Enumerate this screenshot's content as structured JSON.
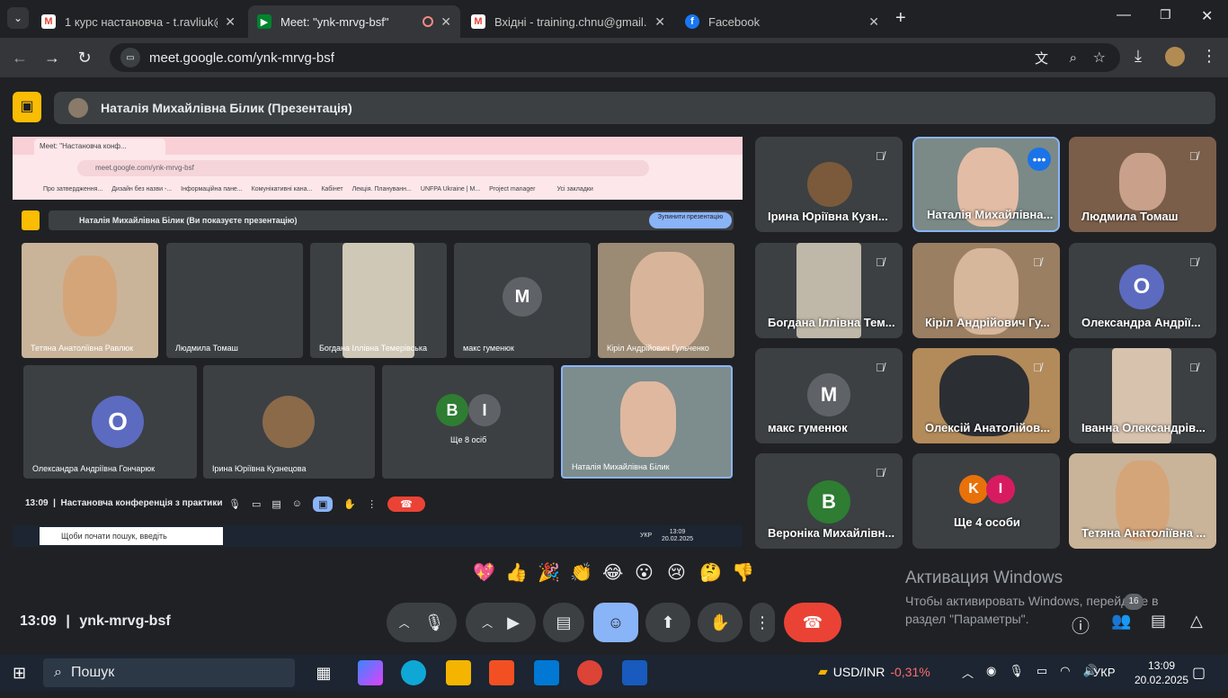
{
  "browser": {
    "tabs": [
      {
        "title": "1 курс настановча - t.ravliuk@",
        "icon": "gmail-icon",
        "active": false
      },
      {
        "title": "Meet: \"ynk-mrvg-bsf\"",
        "icon": "meet-icon",
        "active": true
      },
      {
        "title": "Вхідні - training.chnu@gmail.co",
        "icon": "gmail-icon",
        "active": false
      },
      {
        "title": "Facebook",
        "icon": "facebook-icon",
        "active": false
      }
    ],
    "url": "meet.google.com/ynk-mrvg-bsf"
  },
  "meet": {
    "presenter_banner": "Наталія Михайлівна Білик (Презентація)",
    "meeting_time": "13:09",
    "meeting_code": "ynk-mrvg-bsf",
    "participants_count": "16",
    "tiles": [
      {
        "name": "Ірина Юріївна Кузн...",
        "kind": "photo"
      },
      {
        "name": "Наталія Михайлівна...",
        "kind": "camera"
      },
      {
        "name": "Людмила Томаш",
        "kind": "camera"
      },
      {
        "name": "Богдана Іллівна Тем...",
        "kind": "camera"
      },
      {
        "name": "Кіріл Андрійович Гу...",
        "kind": "camera"
      },
      {
        "name": "Олександра Андрії...",
        "kind": "avatar",
        "letter": "О"
      },
      {
        "name": "макс гуменюк",
        "kind": "avatar",
        "letter": "М"
      },
      {
        "name": "Олексій Анатолійов...",
        "kind": "camera"
      },
      {
        "name": "Іванна Олександрів...",
        "kind": "camera"
      },
      {
        "name": "Вероніка Михайлівн...",
        "kind": "avatar",
        "letter": "В"
      },
      {
        "name": "Ще 4 особи",
        "kind": "more",
        "letters": [
          "K",
          "I"
        ]
      },
      {
        "name": "Тетяна Анатоліївна ...",
        "kind": "camera"
      }
    ],
    "emojis": [
      "💖",
      "👍",
      "🎉",
      "👏",
      "😂",
      "😮",
      "😢",
      "🤔",
      "👎"
    ],
    "activation": {
      "title": "Активация Windows",
      "text": "Чтобы активировать Windows, перейдите в раздел \"Параметры\"."
    }
  },
  "shared_screen": {
    "tab_title": "Meet: \"Настановча конф...",
    "url": "meet.google.com/ynk-mrvg-bsf",
    "bookmarks": [
      "Про затвердження...",
      "Дизайн без назви -...",
      "Інформаційна пане...",
      "Комунікативні кана...",
      "Кабінет",
      "Лекція. Плануванн...",
      "UNFPA Ukraine | М...",
      "Project manager",
      "Усі закладки"
    ],
    "banner": "Наталія Михайлівна Білик (Ви показуєте презентацію)",
    "stop_button": "Зупинити презентацію",
    "tiles_row1": [
      "Тетяна Анатоліївна Равлюк",
      "Людмила Томаш",
      "Богдана Іллівна Темерівська",
      "макс гуменюк",
      "Кіріл Андрійович Гульченко"
    ],
    "tiles_row2": [
      "Олександра Андріївна Гончарюк",
      "Ірина Юріївна Кузнецова",
      "Ще 8 осіб",
      "Наталія Михайлівна Білик"
    ],
    "time": "13:09",
    "meeting_name": "Настановча конференція з практики",
    "search_placeholder": "Щоби почати пошук, введіть",
    "tray_lang": "УКР",
    "tray_time": "13:09",
    "tray_date": "20.02.2025"
  },
  "taskbar": {
    "search_label": "Пошук",
    "ticker": "USD/INR",
    "ticker_change": "-0,31%",
    "lang": "УКР",
    "time": "13:09",
    "date": "20.02.2025"
  },
  "colors": {
    "red": "#ea4335",
    "blue_accent": "#8ab4f8",
    "active_tab": "#35363a"
  }
}
